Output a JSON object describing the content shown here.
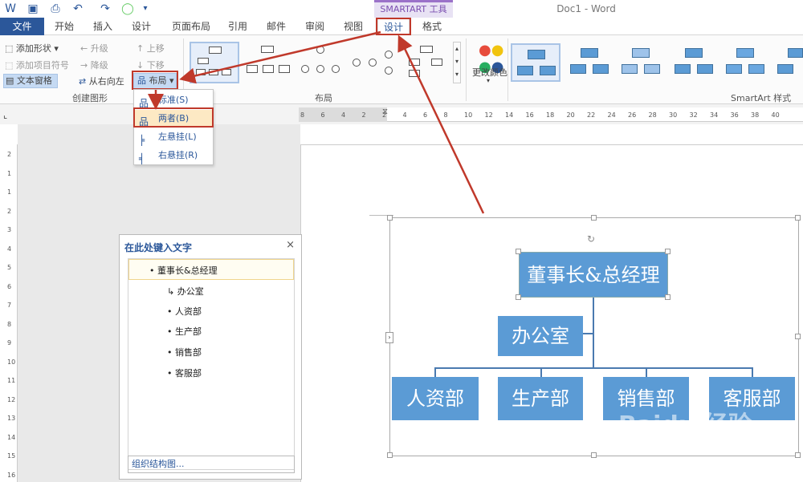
{
  "titlebar": {
    "doc_title": "Doc1 - Word",
    "contextual_tools": "SMARTART 工具"
  },
  "tabs": [
    "文件",
    "开始",
    "插入",
    "设计",
    "页面布局",
    "引用",
    "邮件",
    "审阅",
    "视图",
    "设计",
    "格式"
  ],
  "ribbon": {
    "create_group": {
      "add_shape": "添加形状",
      "add_bullet": "添加项目符号",
      "text_pane": "文本窗格",
      "promote": "升级",
      "demote": "降级",
      "right_to_left": "从右向左",
      "move_up": "上移",
      "move_down": "下移",
      "layout": "布局",
      "label": "创建图形"
    },
    "layouts_label": "布局",
    "change_colors": "更改颜色",
    "styles_label": "SmartArt 样式"
  },
  "layout_dropdown": {
    "items": [
      "标准(S)",
      "两者(B)",
      "左悬挂(L)",
      "右悬挂(R)"
    ]
  },
  "ruler": {
    "h_ticks": [
      "8",
      "6",
      "4",
      "2",
      "2",
      "4",
      "6",
      "8",
      "10",
      "12",
      "14",
      "16",
      "18",
      "20",
      "22",
      "24",
      "26",
      "28",
      "30",
      "32",
      "34",
      "36",
      "38",
      "40"
    ],
    "v_ticks": [
      "2",
      "1",
      "1",
      "2",
      "3",
      "4",
      "5",
      "6",
      "7",
      "8",
      "9",
      "10",
      "11",
      "12",
      "13",
      "14",
      "15",
      "16"
    ]
  },
  "text_pane": {
    "title": "在此处键入文字",
    "close": "×",
    "items": [
      "董事长&总经理",
      "办公室",
      "人资部",
      "生产部",
      "销售部",
      "客服部"
    ],
    "footer": "组织结构图..."
  },
  "smartart": {
    "top": "董事长&总经理",
    "assistant": "办公室",
    "departments": [
      "人资部",
      "生产部",
      "销售部",
      "客服部"
    ]
  },
  "colors": {
    "accent": "#2b579a",
    "node": "#5b9bd5",
    "annotation": "#c0392b",
    "contextual": "#7b4fb0"
  }
}
